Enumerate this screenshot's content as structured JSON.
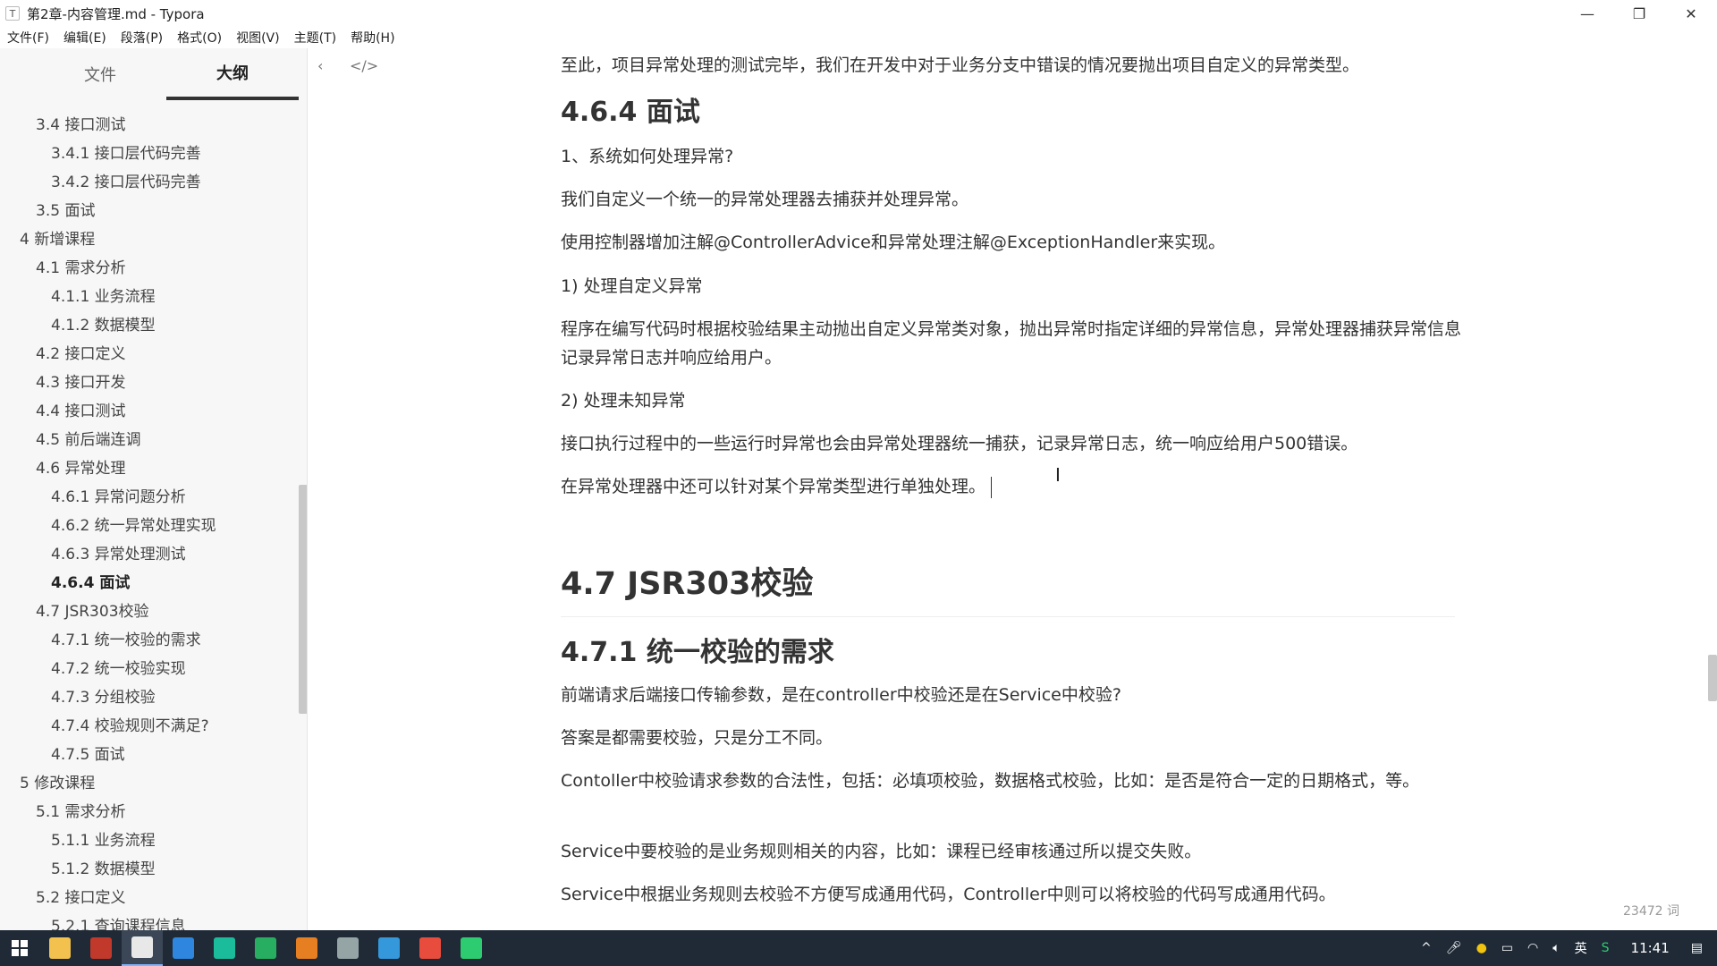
{
  "window": {
    "app_icon": "T",
    "title": "第2章-内容管理.md - Typora",
    "minimize": "—",
    "maximize": "❐",
    "close": "✕"
  },
  "menu": [
    "文件(F)",
    "编辑(E)",
    "段落(P)",
    "格式(O)",
    "视图(V)",
    "主题(T)",
    "帮助(H)"
  ],
  "sidebar": {
    "tabs": [
      "文件",
      "大纲"
    ],
    "active_tab": "大纲",
    "outline": [
      {
        "label": "3.4 接口测试",
        "level": 2
      },
      {
        "label": "3.4.1 接口层代码完善",
        "level": 3
      },
      {
        "label": "3.4.2 接口层代码完善",
        "level": 3
      },
      {
        "label": "3.5 面试",
        "level": 2
      },
      {
        "label": "4 新增课程",
        "level": 1
      },
      {
        "label": "4.1 需求分析",
        "level": 2
      },
      {
        "label": "4.1.1 业务流程",
        "level": 3
      },
      {
        "label": "4.1.2 数据模型",
        "level": 3
      },
      {
        "label": "4.2 接口定义",
        "level": 2
      },
      {
        "label": "4.3 接口开发",
        "level": 2
      },
      {
        "label": "4.4 接口测试",
        "level": 2
      },
      {
        "label": "4.5 前后端连调",
        "level": 2
      },
      {
        "label": "4.6 异常处理",
        "level": 2
      },
      {
        "label": "4.6.1 异常问题分析",
        "level": 3
      },
      {
        "label": "4.6.2 统一异常处理实现",
        "level": 3
      },
      {
        "label": "4.6.3 异常处理测试",
        "level": 3
      },
      {
        "label": "4.6.4 面试",
        "level": 3,
        "active": true
      },
      {
        "label": "4.7 JSR303校验",
        "level": 2
      },
      {
        "label": "4.7.1 统一校验的需求",
        "level": 3
      },
      {
        "label": "4.7.2 统一校验实现",
        "level": 3
      },
      {
        "label": "4.7.3 分组校验",
        "level": 3
      },
      {
        "label": "4.7.4 校验规则不满足?",
        "level": 3
      },
      {
        "label": "4.7.5 面试",
        "level": 3
      },
      {
        "label": "5 修改课程",
        "level": 1
      },
      {
        "label": "5.1 需求分析",
        "level": 2
      },
      {
        "label": "5.1.1 业务流程",
        "level": 3
      },
      {
        "label": "5.1.2 数据模型",
        "level": 3
      },
      {
        "label": "5.2 接口定义",
        "level": 2
      },
      {
        "label": "5.2.1 查询课程信息",
        "level": 3
      }
    ],
    "footer_back": "‹",
    "footer_source": "</>"
  },
  "doc": {
    "p_intro": "至此，项目异常处理的测试完毕，我们在开发中对于业务分支中错误的情况要抛出项目自定义的异常类型。",
    "h_464": "4.6.4 面试",
    "q1": "1、系统如何处理异常?",
    "a1": "我们自定义一个统一的异常处理器去捕获并处理异常。",
    "a2": "使用控制器增加注解@ControllerAdvice和异常处理注解@ExceptionHandler来实现。",
    "s1": "1) 处理自定义异常",
    "s1_text": "程序在编写代码时根据校验结果主动抛出自定义异常类对象，抛出异常时指定详细的异常信息，异常处理器捕获异常信息记录异常日志并响应给用户。",
    "s2": "2) 处理未知异常",
    "s2_text": "接口执行过程中的一些运行时异常也会由异常处理器统一捕获，记录异常日志，统一响应给用户500错误。",
    "s3_text": "在异常处理器中还可以针对某个异常类型进行单独处理。",
    "h_47": "4.7 JSR303校验",
    "h_471": "4.7.1 统一校验的需求",
    "v1": "前端请求后端接口传输参数，是在controller中校验还是在Service中校验?",
    "v2": "答案是都需要校验，只是分工不同。",
    "v3": "Contoller中校验请求参数的合法性，包括：必填项校验，数据格式校验，比如：是否是符合一定的日期格式，等。",
    "v4": "Service中要校验的是业务规则相关的内容，比如：课程已经审核通过所以提交失败。",
    "v5": "Service中根据业务规则去校验不方便写成通用代码，Controller中则可以将校验的代码写成通用代码。"
  },
  "status": {
    "word_count": "23472 词"
  },
  "taskbar": {
    "apps": [
      {
        "name": "file-explorer",
        "color": "#f2c14e"
      },
      {
        "name": "app-red",
        "color": "#c0392b"
      },
      {
        "name": "typora",
        "color": "#e8e8e8",
        "active": true
      },
      {
        "name": "app-blue",
        "color": "#2e86de"
      },
      {
        "name": "app-teal",
        "color": "#1abc9c"
      },
      {
        "name": "app-green-dark",
        "color": "#27ae60"
      },
      {
        "name": "app-vlc",
        "color": "#e67e22"
      },
      {
        "name": "app-circle",
        "color": "#95a5a6"
      },
      {
        "name": "app-edge",
        "color": "#3498db"
      },
      {
        "name": "chrome",
        "color": "#e74c3c"
      },
      {
        "name": "app-green",
        "color": "#2ecc71"
      }
    ],
    "tray_chevron": "^",
    "ime": "英",
    "clock": "11:41"
  }
}
